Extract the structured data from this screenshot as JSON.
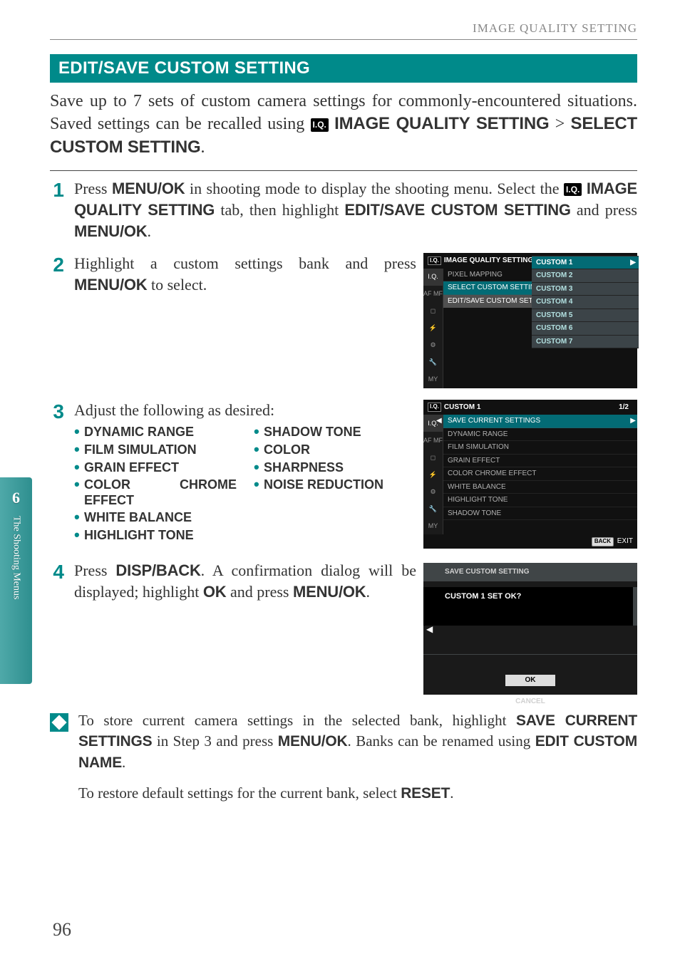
{
  "runningTitle": "IMAGE QUALITY SETTING",
  "sectionTitle": "EDIT/SAVE CUSTOM SETTING",
  "intro": {
    "pre": "Save up to 7 sets of custom camera settings for commonly-encountered situations.  Saved settings can be recalled using ",
    "linkA": "IMAGE QUALITY SETTING",
    "gt": " > ",
    "linkB": "SELECT CUSTOM SETTING",
    "end": "."
  },
  "steps": {
    "s1": {
      "num": "1",
      "t1": "Press ",
      "b1": "MENU/OK",
      "t2": " in shooting mode to display the shooting menu.  Select the ",
      "b2": "IMAGE QUALITY SETTING",
      "t3": " tab, then highlight ",
      "b3": "EDIT/SAVE CUSTOM SETTING",
      "t4": " and press ",
      "b4": "MENU/OK",
      "t5": "."
    },
    "s2": {
      "num": "2",
      "t1": "Highlight a custom settings bank and press ",
      "b1": "MENU/OK",
      "t2": " to select."
    },
    "s3": {
      "num": "3",
      "lead": "Adjust the following as desired:",
      "colA": [
        "DYNAMIC RANGE",
        "FILM SIMULATION",
        "GRAIN EFFECT",
        "COLOR CHROME EFFECT",
        "WHITE BALANCE",
        "HIGHLIGHT TONE"
      ],
      "colB": [
        "SHADOW TONE",
        "COLOR",
        "SHARPNESS",
        "NOISE REDUCTION"
      ]
    },
    "s4": {
      "num": "4",
      "t1": "Press ",
      "b1": "DISP/BACK",
      "t2": ". A confirmation dialog will be displayed; highlight ",
      "b2": "OK",
      "t3": " and press ",
      "b3": "MENU/OK",
      "t4": "."
    }
  },
  "cam2": {
    "title": "IMAGE QUALITY SETTING",
    "items": [
      "PIXEL MAPPING",
      "SELECT CUSTOM SETTING",
      "EDIT/SAVE CUSTOM SETTING"
    ],
    "popup": [
      "CUSTOM 1",
      "CUSTOM 2",
      "CUSTOM 3",
      "CUSTOM 4",
      "CUSTOM 5",
      "CUSTOM 6",
      "CUSTOM 7"
    ],
    "popupSel": 0,
    "tabs": [
      "I.Q.",
      "AF MF",
      "◻",
      "⚡",
      "⚙",
      "🔧",
      "MY"
    ]
  },
  "cam3": {
    "title": "CUSTOM 1",
    "pager": "1/2",
    "items": [
      "SAVE CURRENT SETTINGS",
      "DYNAMIC RANGE",
      "FILM SIMULATION",
      "GRAIN EFFECT",
      "COLOR CHROME EFFECT",
      "WHITE BALANCE",
      "HIGHLIGHT TONE",
      "SHADOW TONE"
    ],
    "tabs": [
      "I.Q.",
      "AF MF",
      "◻",
      "⚡",
      "⚙",
      "🔧",
      "MY"
    ],
    "exitLabel": "EXIT",
    "backLabel": "BACK"
  },
  "dlg": {
    "title": "SAVE CUSTOM SETTING",
    "question": "CUSTOM 1 SET OK?",
    "options": [
      "OK",
      "CANCEL"
    ],
    "sel": 0
  },
  "tip": {
    "t1": "To store current camera settings in the selected bank, highlight ",
    "b1": "SAVE CURRENT SETTINGS",
    "t2": " in Step 3 and press ",
    "b2": "MENU/OK",
    "t3": ". Banks can be renamed using ",
    "b3": "EDIT CUSTOM NAME",
    "t4": ".",
    "p2a": "To restore default settings for the current bank, select ",
    "p2b": "RESET",
    "p2c": "."
  },
  "chapter": {
    "num": "6",
    "label": "The Shooting Menus"
  },
  "pageNumber": "96",
  "iqBadge": "I.Q."
}
